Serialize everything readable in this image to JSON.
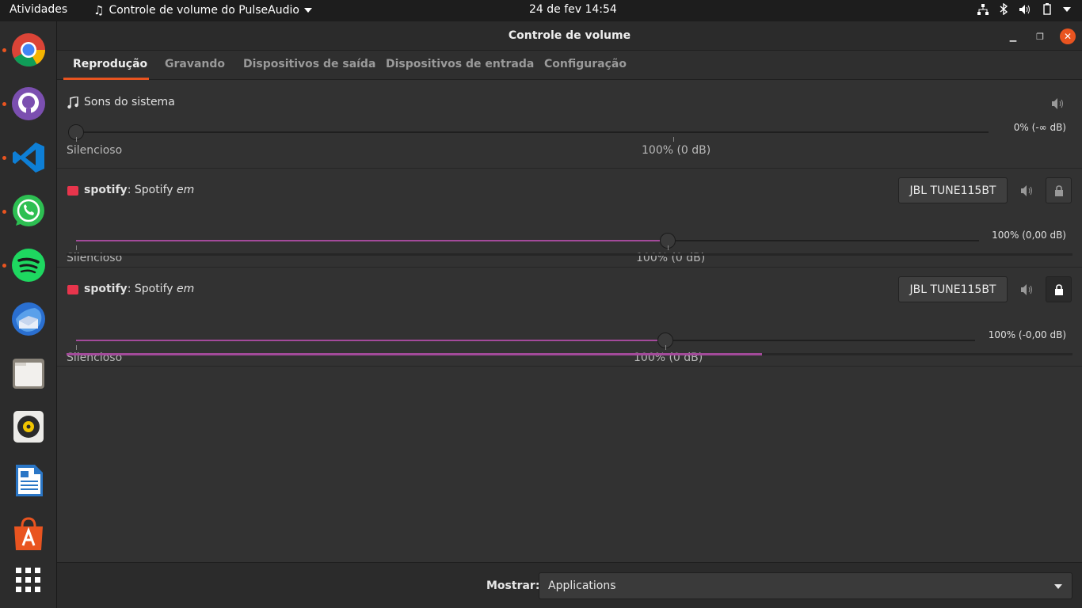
{
  "topbar": {
    "activities": "Atividades",
    "app_menu": "Controle de volume do PulseAudio",
    "clock": "24 de fev  14:54"
  },
  "dock": {
    "apps": [
      {
        "name": "chrome-icon",
        "running": true
      },
      {
        "name": "github-desktop-icon",
        "running": true
      },
      {
        "name": "vscode-icon",
        "running": true
      },
      {
        "name": "whatsapp-icon",
        "running": true
      },
      {
        "name": "spotify-icon",
        "running": true
      },
      {
        "name": "thunderbird-icon",
        "running": false
      },
      {
        "name": "files-icon",
        "running": false
      },
      {
        "name": "rhythmbox-icon",
        "running": false
      },
      {
        "name": "libreoffice-writer-icon",
        "running": false
      },
      {
        "name": "software-center-icon",
        "running": false
      },
      {
        "name": "show-apps-icon",
        "running": false
      }
    ]
  },
  "window": {
    "title": "Controle de volume",
    "tabs": [
      "Reprodução",
      "Gravando",
      "Dispositivos de saída",
      "Dispositivos de entrada",
      "Configuração"
    ],
    "active_tab": 0
  },
  "streams": [
    {
      "app": "",
      "name": "Sons do sistema",
      "suffix": "",
      "volume_label": "0% (-∞ dB)",
      "volume_fraction": 0.0,
      "mute_label": "Silencioso",
      "ref_label": "100% (0 dB)"
    },
    {
      "app": "spotify",
      "name": ": Spotify ",
      "suffix": "em",
      "device": "JBL TUNE115BT",
      "volume_label": "100% (0,00 dB)",
      "volume_fraction": 1.0,
      "mute_label": "Silencioso",
      "ref_label": "100% (0 dB)",
      "level_fraction": 0.0,
      "locked": false
    },
    {
      "app": "spotify",
      "name": ": Spotify ",
      "suffix": "em",
      "device": "JBL TUNE115BT",
      "volume_label": "100% (-0,00 dB)",
      "volume_fraction": 1.0,
      "mute_label": "Silencioso",
      "ref_label": "100% (0 dB)",
      "level_fraction": 0.69,
      "locked": true
    }
  ],
  "bottom": {
    "show_label": "Mostrar:",
    "show_value": "Applications"
  },
  "colors": {
    "accent": "#e95420",
    "slider_fill": "#a34a9a"
  }
}
